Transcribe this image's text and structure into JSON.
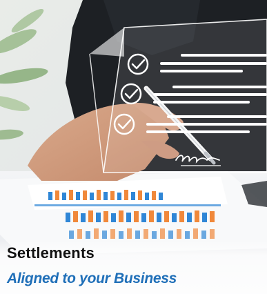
{
  "card": {
    "title": "Settlements",
    "subtitle": "Aligned to your Business",
    "image": {
      "icons": [
        "check-circle-icon",
        "check-circle-icon",
        "check-circle-icon",
        "pen-icon",
        "signature-icon"
      ]
    }
  },
  "colors": {
    "title": "#111111",
    "subtitle": "#1f6fb8",
    "accent_blue": "#2f86d6",
    "accent_orange": "#f0883a",
    "shirt": "#1d2024"
  }
}
